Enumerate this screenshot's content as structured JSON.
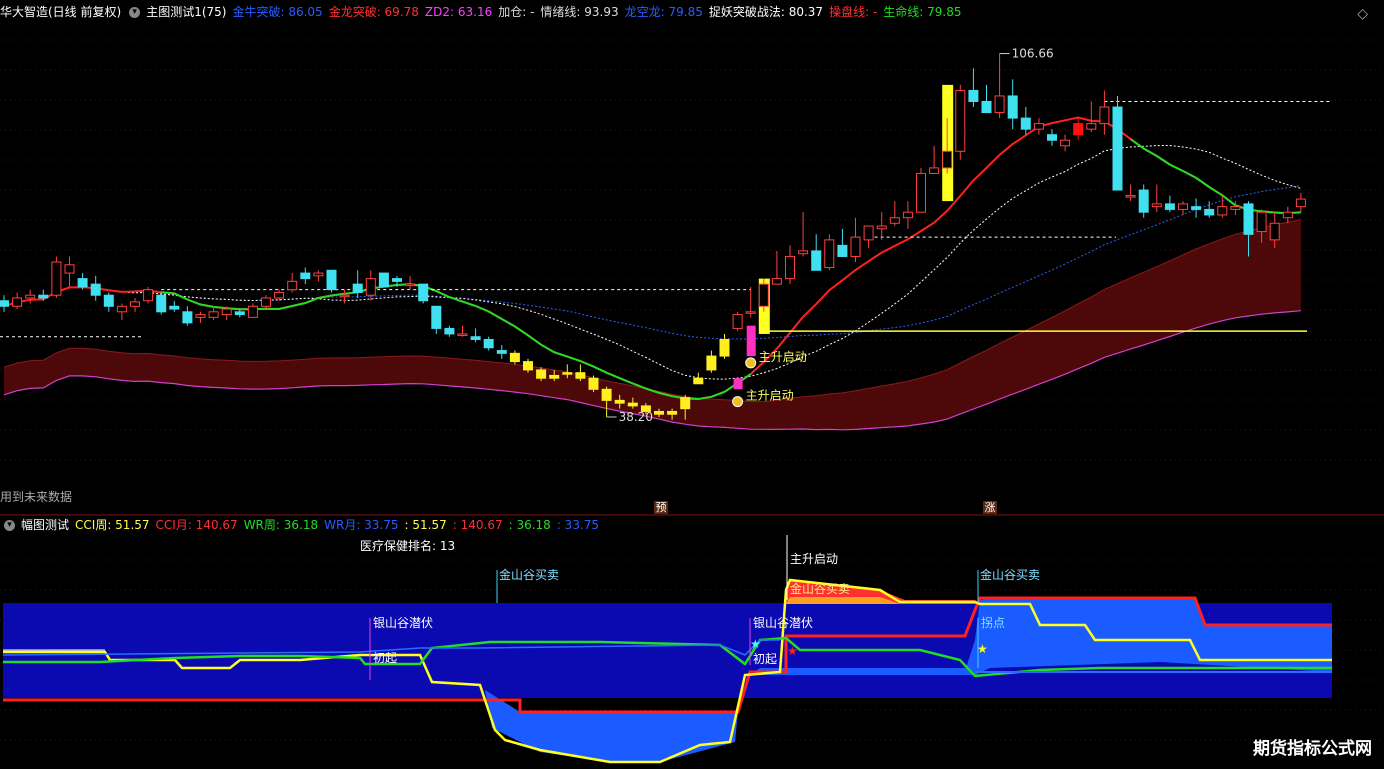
{
  "header": {
    "title": "华大智造(日线 前复权)",
    "indicator_name": "主图测试1(75)",
    "items": [
      {
        "label": "金牛突破: 86.05",
        "color": "#2b5cff"
      },
      {
        "label": "金龙突破: 69.78",
        "color": "#ff3030"
      },
      {
        "label": "ZD2: 63.16",
        "color": "#ff40ff"
      },
      {
        "label": "加仓: -",
        "color": "#dddddd"
      },
      {
        "label": "情绪线: 93.93",
        "color": "#dddddd"
      },
      {
        "label": "龙空龙: 79.85",
        "color": "#2b5cff"
      },
      {
        "label": "捉妖突破战法: 80.37",
        "color": "#ffffff"
      },
      {
        "label": "操盘线: -",
        "color": "#ff3030"
      },
      {
        "label": "生命线: 79.85",
        "color": "#22dd22"
      }
    ],
    "corner_icon": "diamond-icon"
  },
  "main_chart": {
    "future_note": "用到未来数据",
    "high_label": "106.66",
    "low_label": "38.20",
    "signal_label": "主升启动",
    "flag_pre": "预",
    "flag_up": "涨"
  },
  "sub_header": {
    "indicator_name": "幅图测试",
    "items": [
      {
        "label": "CCI周: 51.57",
        "color": "#ffff40"
      },
      {
        "label": "CCI月: 140.67",
        "color": "#ff3030"
      },
      {
        "label": "WR周: 36.18",
        "color": "#22dd22"
      },
      {
        "label": "WR月: 33.75",
        "color": "#2b5cff"
      },
      {
        "label": ": 51.57",
        "color": "#ffff40"
      },
      {
        "label": ": 140.67",
        "color": "#ff3030"
      },
      {
        "label": ": 36.18",
        "color": "#22dd22"
      },
      {
        "label": ": 33.75",
        "color": "#2b5cff"
      }
    ]
  },
  "sub_chart": {
    "rank_label": "医疗保健排名: 13",
    "labels": {
      "valley_buy": "金山谷买卖",
      "silver_valley": "银山谷潜伏",
      "start": "初起",
      "main_rise": "主升启动",
      "turn": "拐点"
    }
  },
  "watermark": "期货指标公式网",
  "chart_data": {
    "type": "candlestick",
    "price_axis_range": [
      26,
      112
    ],
    "candles": [
      [
        62,
        63,
        60,
        61
      ],
      [
        61,
        63.5,
        60.5,
        62.5
      ],
      [
        62.5,
        64,
        61.5,
        63
      ],
      [
        63,
        64,
        62,
        62.5
      ],
      [
        63,
        70,
        62.5,
        69
      ],
      [
        67,
        70,
        64.5,
        68.5
      ],
      [
        66,
        67,
        64,
        64.5
      ],
      [
        65,
        66.5,
        62,
        63
      ],
      [
        63,
        63.5,
        60,
        61
      ],
      [
        60,
        61.5,
        58.5,
        61
      ],
      [
        61,
        62.5,
        60,
        61.8
      ],
      [
        62,
        64.5,
        61.5,
        64
      ],
      [
        63,
        63.5,
        59.5,
        60
      ],
      [
        61,
        62,
        60,
        60.5
      ],
      [
        60,
        61,
        57.5,
        58
      ],
      [
        59,
        60,
        58,
        59.5
      ],
      [
        59,
        61,
        58.5,
        60
      ],
      [
        59.5,
        61,
        58.5,
        60.5
      ],
      [
        60,
        60.5,
        59,
        59.5
      ],
      [
        59,
        61.5,
        59,
        61
      ],
      [
        61,
        63,
        60.5,
        62.5
      ],
      [
        62.5,
        64,
        62,
        63.5
      ],
      [
        64,
        67,
        63.5,
        65.5
      ],
      [
        67,
        68,
        65,
        66
      ],
      [
        66.5,
        67.5,
        65.5,
        67
      ],
      [
        67.5,
        67.5,
        63.5,
        64
      ],
      [
        63,
        64,
        61.5,
        63
      ],
      [
        65,
        67.5,
        62.5,
        63.5
      ],
      [
        63,
        67.5,
        62,
        66
      ],
      [
        67,
        67,
        64.5,
        64.5
      ],
      [
        66,
        66.5,
        64.5,
        65.5
      ],
      [
        65,
        66.5,
        64,
        65
      ],
      [
        65,
        65,
        61.5,
        62
      ],
      [
        61,
        61,
        56,
        57
      ],
      [
        57,
        57.5,
        55.5,
        56
      ],
      [
        56,
        57.5,
        55.5,
        56
      ],
      [
        55.5,
        57,
        54.5,
        55
      ],
      [
        55,
        55.5,
        53,
        53.5
      ],
      [
        53,
        54,
        51.5,
        52.5
      ],
      [
        52.5,
        53,
        50.5,
        51
      ],
      [
        51,
        51.5,
        49,
        49.5
      ],
      [
        49.5,
        50,
        47.5,
        48
      ],
      [
        48,
        49.5,
        47.5,
        48.5
      ],
      [
        49,
        50.5,
        48,
        49
      ],
      [
        49,
        50.5,
        47.5,
        48
      ],
      [
        48,
        48.5,
        45.5,
        46
      ],
      [
        46,
        46.5,
        41,
        44
      ],
      [
        44,
        45,
        42.5,
        43.5
      ],
      [
        43.5,
        44.5,
        42.5,
        43
      ],
      [
        43,
        43.5,
        41.5,
        42
      ],
      [
        42,
        42.5,
        41,
        41.5
      ],
      [
        41.5,
        42.5,
        40.5,
        42
      ],
      [
        42.5,
        45,
        40.5,
        44.5
      ],
      [
        47,
        49,
        47,
        48
      ],
      [
        49.5,
        53,
        49,
        52
      ],
      [
        52,
        56,
        51.5,
        55
      ],
      [
        57,
        60,
        56.5,
        59.5
      ],
      [
        60,
        64.5,
        59,
        60
      ],
      [
        61,
        66,
        60,
        65
      ],
      [
        65,
        71,
        65,
        66
      ],
      [
        66,
        72,
        65,
        70
      ],
      [
        70.5,
        78,
        70,
        71
      ],
      [
        71,
        74,
        67.5,
        67.5
      ],
      [
        68,
        74,
        67.5,
        73
      ],
      [
        72,
        75,
        70,
        70
      ],
      [
        70,
        77,
        69,
        73.5
      ],
      [
        73,
        75.5,
        71.5,
        75.5
      ],
      [
        75,
        78,
        73,
        75.5
      ],
      [
        76,
        80,
        75.5,
        77
      ],
      [
        77,
        80,
        75,
        78
      ],
      [
        78,
        86,
        78,
        85
      ],
      [
        85,
        90,
        85,
        86
      ],
      [
        86,
        95,
        85,
        89
      ],
      [
        89,
        101,
        87.5,
        100
      ],
      [
        100,
        104,
        97,
        98
      ],
      [
        98,
        101,
        96,
        96
      ],
      [
        96,
        106.66,
        95,
        99
      ],
      [
        99,
        102,
        93,
        95
      ],
      [
        95,
        97,
        92,
        93
      ],
      [
        93,
        95,
        92,
        94
      ],
      [
        92,
        93,
        90,
        91
      ],
      [
        90,
        92,
        89,
        91
      ],
      [
        92,
        95,
        91,
        94
      ],
      [
        93,
        98,
        92.5,
        94
      ],
      [
        94,
        100,
        92,
        97
      ],
      [
        97,
        99,
        82,
        82
      ],
      [
        81,
        83,
        80,
        81
      ],
      [
        82,
        83,
        77,
        78
      ],
      [
        79,
        83,
        78,
        79.5
      ],
      [
        79.5,
        81,
        78,
        78.5
      ],
      [
        78.5,
        80,
        77.5,
        79.5
      ],
      [
        79,
        80.5,
        77,
        78.5
      ],
      [
        78.5,
        80,
        77,
        77.5
      ],
      [
        77.5,
        81,
        77,
        79
      ],
      [
        78.5,
        80,
        77.5,
        79
      ],
      [
        79.5,
        80,
        70,
        74
      ],
      [
        74.5,
        78.5,
        72.5,
        78
      ],
      [
        73,
        78,
        71.5,
        76
      ],
      [
        77,
        79,
        76,
        78
      ],
      [
        79,
        81.5,
        78,
        80.37
      ]
    ],
    "yellow_bars": [
      {
        "index": 72,
        "low": 80,
        "high": 101
      },
      {
        "index": 58,
        "low": 56,
        "high": 66
      }
    ],
    "magenta_bars": [
      {
        "index": 57,
        "low": 52,
        "high": 57.5
      },
      {
        "index": 56,
        "low": 46,
        "high": 48
      }
    ],
    "series": [
      {
        "name": "操盘线",
        "color": "#ff2020"
      },
      {
        "name": "生命线",
        "color": "#22dd22"
      },
      {
        "name": "情绪线",
        "color": "#ffffff"
      },
      {
        "name": "龙空龙",
        "color": "#2b5cff"
      }
    ],
    "sub_series": [
      {
        "name": "CCI周",
        "color": "#ffff40"
      },
      {
        "name": "CCI月",
        "color": "#ff3030"
      },
      {
        "name": "WR周",
        "color": "#22dd22"
      },
      {
        "name": "WR月",
        "color": "#2b5cff"
      }
    ]
  }
}
